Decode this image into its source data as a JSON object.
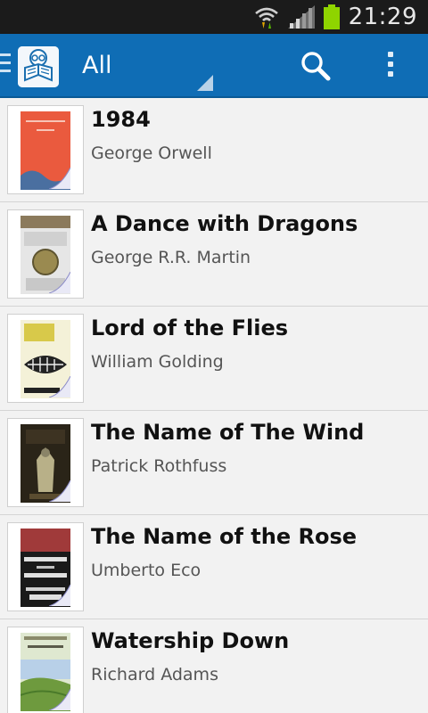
{
  "status_bar": {
    "time": "21:29"
  },
  "action_bar": {
    "filter_label": "All"
  },
  "books": [
    {
      "title": "1984",
      "author": "George Orwell"
    },
    {
      "title": "A Dance with Dragons",
      "author": "George R.R. Martin"
    },
    {
      "title": "Lord of the Flies",
      "author": "William Golding"
    },
    {
      "title": "The Name of The Wind",
      "author": "Patrick Rothfuss"
    },
    {
      "title": "The Name of the Rose",
      "author": "Umberto Eco"
    },
    {
      "title": "Watership Down",
      "author": "Richard Adams"
    }
  ],
  "colors": {
    "action_bar": "#0f6db5",
    "status_bar": "#1b1b1b",
    "background": "#f2f2f2",
    "battery": "#8fd400"
  },
  "icons": [
    "wifi-icon",
    "signal-icon",
    "battery-icon",
    "drawer-icon",
    "app-logo-icon",
    "search-icon",
    "overflow-menu-icon",
    "page-curl-icon"
  ]
}
